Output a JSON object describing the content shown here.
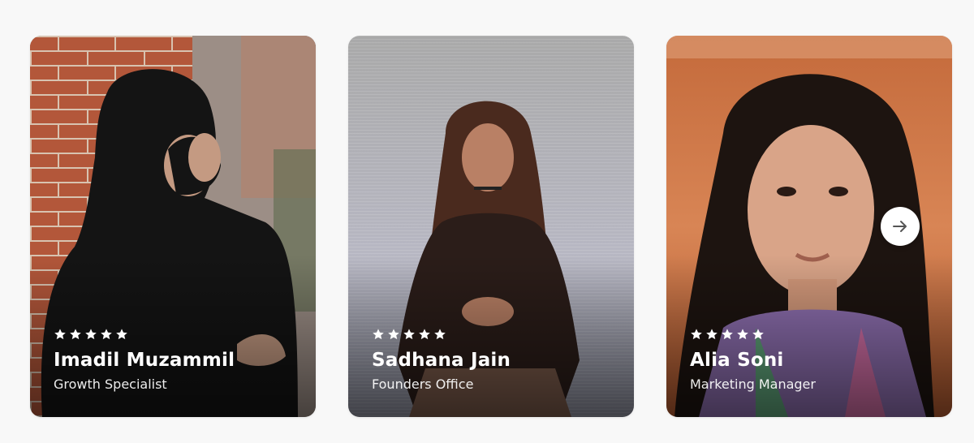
{
  "cards": [
    {
      "name": "Imadil Muzammil",
      "role": "Growth Specialist",
      "rating": 5,
      "photo_icon": "portrait-photo"
    },
    {
      "name": "Sadhana Jain",
      "role": "Founders Office",
      "rating": 5,
      "photo_icon": "portrait-photo"
    },
    {
      "name": "Alia Soni",
      "role": "Marketing Manager",
      "rating": 5,
      "photo_icon": "portrait-photo"
    }
  ],
  "next_button": {
    "icon": "arrow-right-icon"
  },
  "colors": {
    "page_background": "#f8f8f8",
    "text": "#ffffff",
    "star": "#ffffff",
    "button_background": "#ffffff",
    "arrow": "#555555"
  }
}
